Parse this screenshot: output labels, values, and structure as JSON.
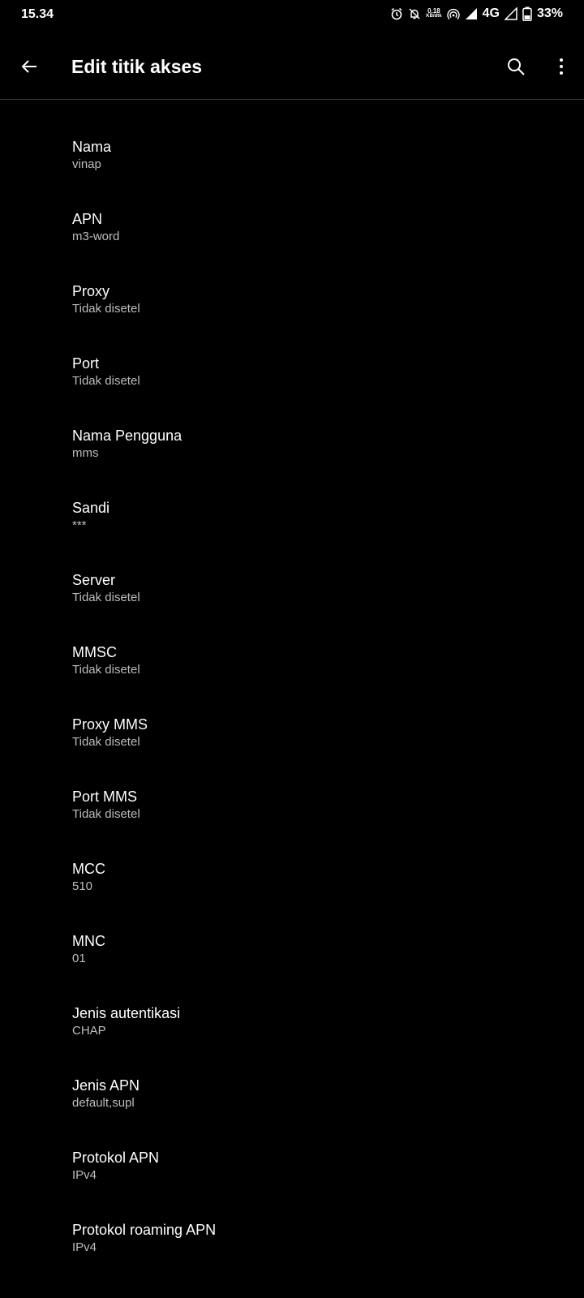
{
  "status_bar": {
    "time": "15.34",
    "speed_value": "0.18",
    "speed_unit": "KB/dtk",
    "network": "4G",
    "battery": "33%",
    "icons": [
      "alarm-icon",
      "notifications-off-icon",
      "network-speed-icon",
      "hotspot-icon",
      "signal-icon",
      "signal-2-icon",
      "battery-icon"
    ]
  },
  "app_bar": {
    "title": "Edit titik akses",
    "icons": [
      "back-arrow-icon",
      "search-icon",
      "more-vertical-icon"
    ]
  },
  "settings": [
    {
      "title": "Nama",
      "value": "vinap"
    },
    {
      "title": "APN",
      "value": "m3-word"
    },
    {
      "title": "Proxy",
      "value": "Tidak disetel"
    },
    {
      "title": "Port",
      "value": "Tidak disetel"
    },
    {
      "title": "Nama Pengguna",
      "value": "mms"
    },
    {
      "title": "Sandi",
      "value": "***"
    },
    {
      "title": "Server",
      "value": "Tidak disetel"
    },
    {
      "title": "MMSC",
      "value": "Tidak disetel"
    },
    {
      "title": "Proxy MMS",
      "value": "Tidak disetel"
    },
    {
      "title": "Port MMS",
      "value": "Tidak disetel"
    },
    {
      "title": "MCC",
      "value": "510"
    },
    {
      "title": "MNC",
      "value": "01"
    },
    {
      "title": "Jenis autentikasi",
      "value": "CHAP"
    },
    {
      "title": "Jenis APN",
      "value": "default,supl"
    },
    {
      "title": "Protokol APN",
      "value": "IPv4"
    },
    {
      "title": "Protokol roaming APN",
      "value": "IPv4"
    }
  ]
}
